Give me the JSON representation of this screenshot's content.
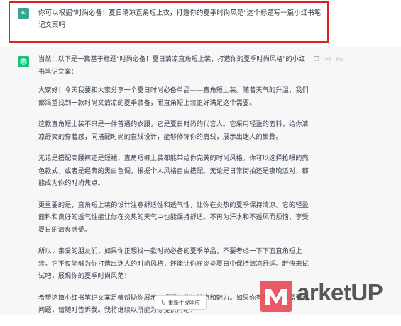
{
  "user": {
    "avatar_text": "BD",
    "message": "你可以根据\"时尚必备！夏日清凉直角短上衣，打造你的夏季时尚风范\"这个标题写一篇小红书笔记文案吗"
  },
  "assistant": {
    "intro": "当然！以下是一篇基于标题\"时尚必备！夏日清凉直角短上装，打造你的夏季时尚风格\"的小红书笔记文案：",
    "paragraphs": [
      "大家好！今天我要和大家分享一个夏日时尚必备单品——直角短上装。随着天气的升温，我们都渴望找到一款时尚又清凉的夏季装备，而直角短上装正好满足这个需要。",
      "这款直角短上装不只是一件普通的衣服，它是夏日时尚的代言人。它采用轻盈的面料，给你清凉舒爽的穿着感，同搭配时尚的直线设计，能够修饰你的肩线，展示出迷人的锁骨。",
      "无论是搭配高腰裤还是短裙，直角短裤上装都能带给你完美的时尚风格。你可以选择抢眼的亮色款式，或者是经典的黑白色调，根据个人风格自由搭配。无论是日常街拍还是夜晚派对，都能成为你的时尚焦点。",
      "更重要的是，直角短上装的设计注意舒适性和透气性，让你在炎热的夏季保持清凉。它的轻盈面料和良好的透气性能让你在炎热的天气中也能保持舒适。不再为汗水和不透风而烦恼，享受夏日的清爽感受。",
      "所以，亲爱的朋友们，如果你正想找一款时尚必备的夏季单品，不要考虑一下下面直角短上装。它不仅能够为你打造出迷人的时尚风格，还能让你在炎炎夏日中保持清凉舒适。赶快来试试吧，展现你的夏季时尚风范！",
      "希望这篇小红书笔记文案足够帮助你展示直播短上装的特点和魅力。如果你有其他问题需要或问题，请随时告诉我。我将继续以所能为你提供帮助！"
    ]
  },
  "actions": {
    "regenerate_label": "重新生成响应",
    "regenerate_icon": "refresh-icon"
  },
  "watermark": {
    "text": "arketUP",
    "logo_letter": "M"
  },
  "colors": {
    "highlight": "#e0201c",
    "gpt_green": "#19c37d",
    "user_avatar": "#3aa292",
    "watermark_red": "#e84c5a"
  }
}
